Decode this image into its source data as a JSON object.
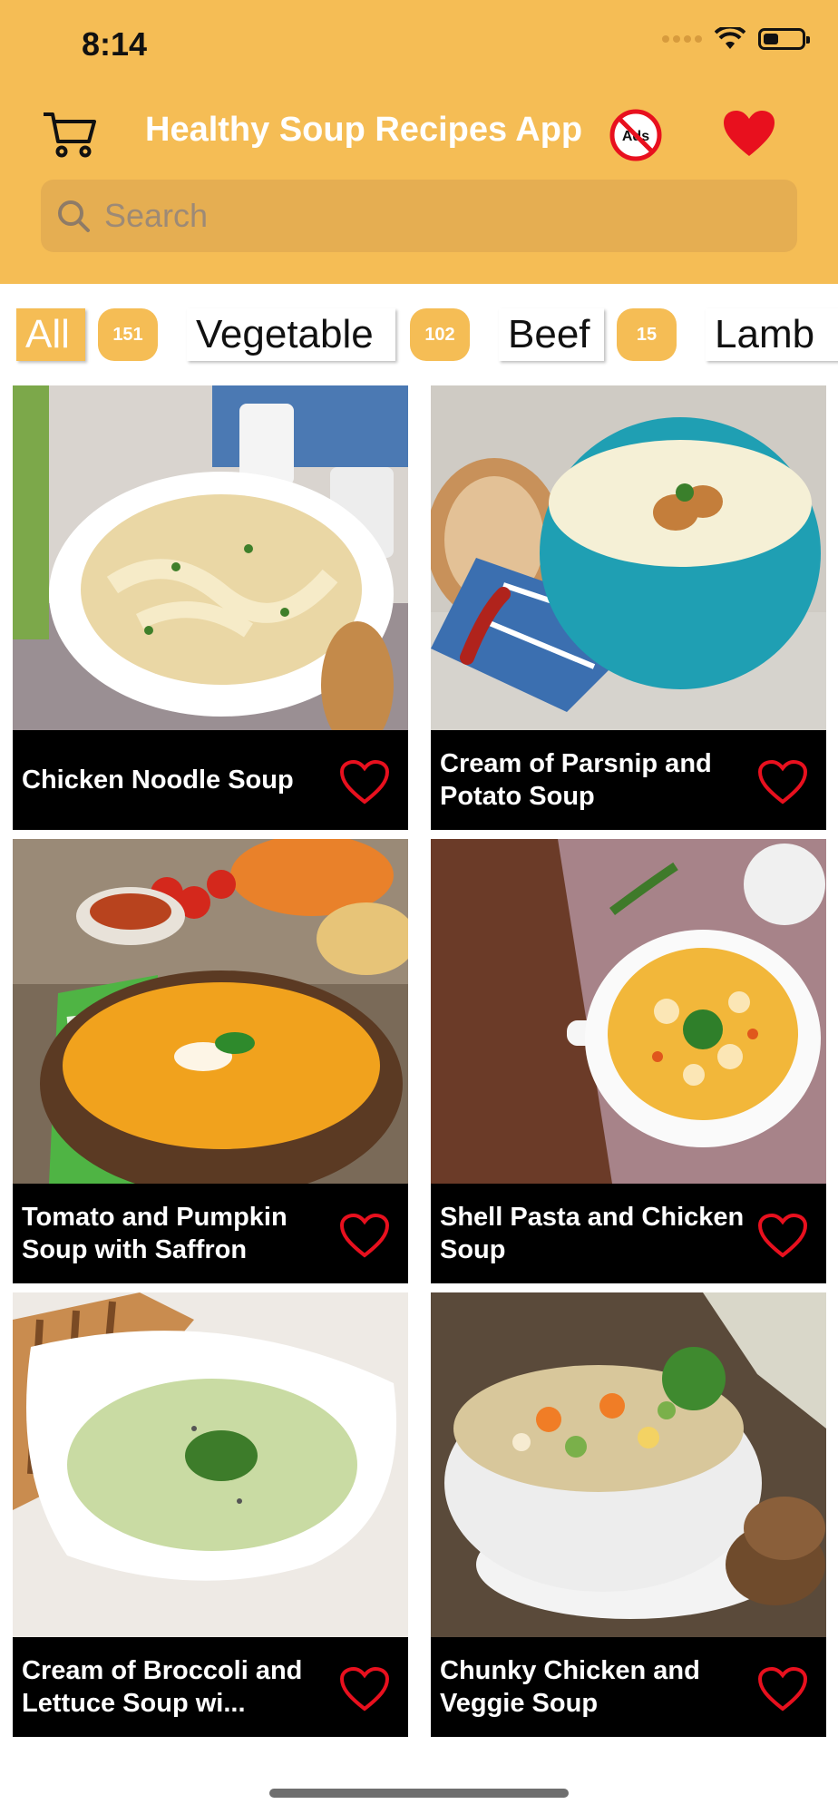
{
  "status_bar": {
    "time": "8:14",
    "battery_level": 0.4
  },
  "header": {
    "title": "Healthy Soup Recipes App",
    "no_ads_label": "Ads",
    "accent_color": "#F5BD55",
    "heart_color": "#E8101E"
  },
  "search": {
    "placeholder": "Search"
  },
  "categories": [
    {
      "label": "All",
      "count": "151",
      "active": true
    },
    {
      "label": "Vegetable",
      "count": "102",
      "active": false
    },
    {
      "label": "Beef",
      "count": "15",
      "active": false
    },
    {
      "label": "Lamb",
      "count": "",
      "active": false
    }
  ],
  "recipes": [
    {
      "name": "Chicken Noodle Soup",
      "icon": "noodle-soup-photo"
    },
    {
      "name": "Cream of Parsnip and Potato Soup",
      "icon": "parsnip-soup-photo"
    },
    {
      "name": "Tomato and Pumpkin Soup with Saffron",
      "icon": "pumpkin-soup-photo"
    },
    {
      "name": "Shell Pasta and Chicken Soup",
      "icon": "pasta-soup-photo"
    },
    {
      "name": "Cream of Broccoli and Lettuce Soup wi...",
      "icon": "broccoli-soup-photo"
    },
    {
      "name": "Chunky Chicken and Veggie Soup",
      "icon": "veggie-soup-photo"
    }
  ]
}
